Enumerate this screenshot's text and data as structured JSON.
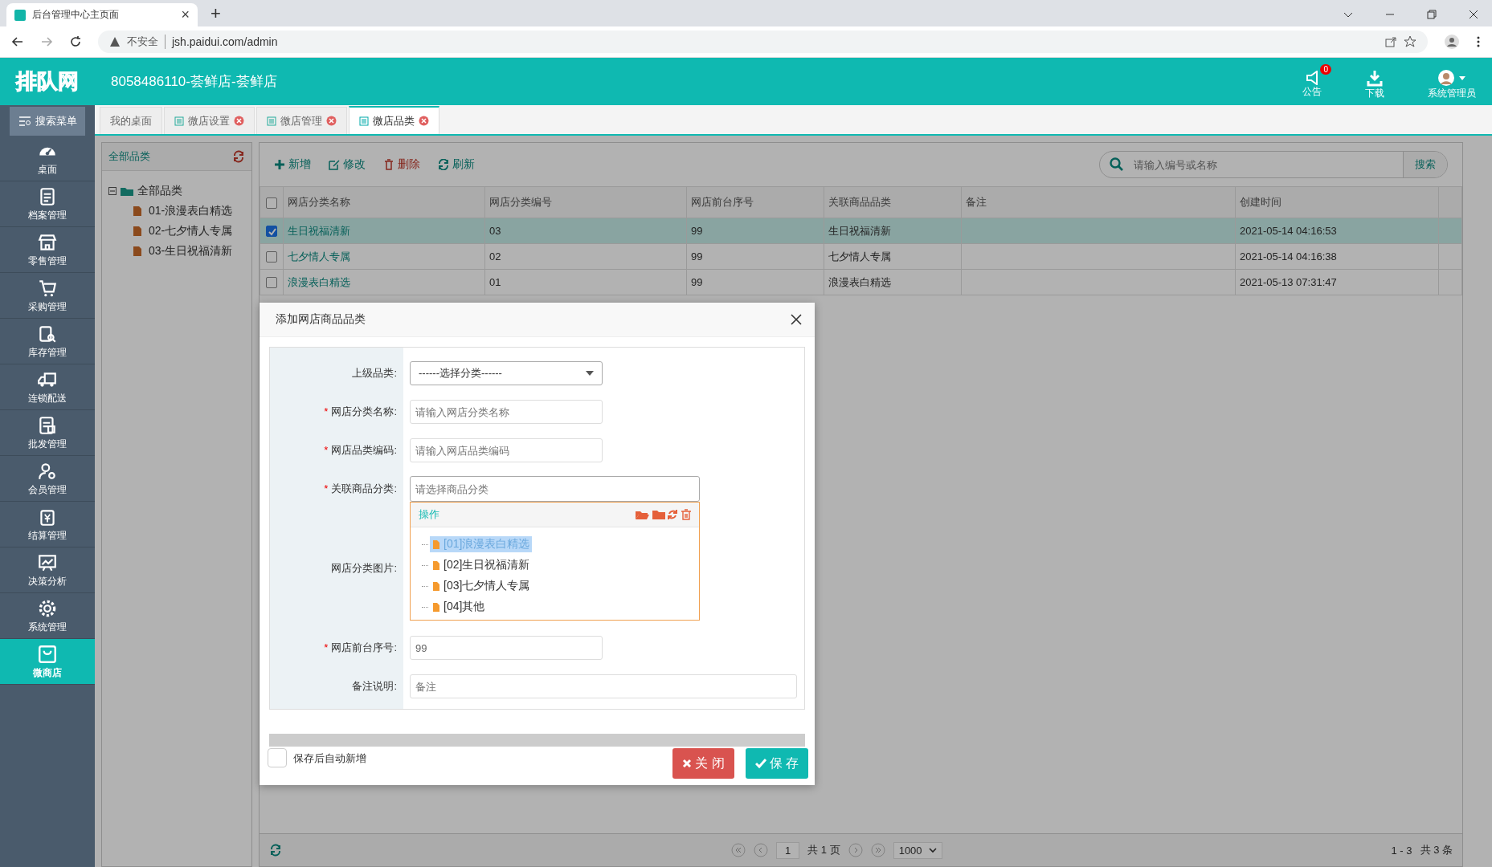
{
  "browser": {
    "tab_title": "后台管理中心主页面",
    "close": "×",
    "new_tab": "+",
    "url_warning": "不安全",
    "url": "jsh.paidui.com/admin"
  },
  "header": {
    "logo": "排队网",
    "store_title": "8058486110-荟鲜店-荟鲜店",
    "notice": {
      "label": "公告",
      "badge": "0"
    },
    "download": "下载",
    "user": "系统管理员"
  },
  "sidebar": {
    "search_menu": "搜索菜单",
    "items": [
      {
        "label": "桌面",
        "selected": false
      },
      {
        "label": "档案管理",
        "selected": false
      },
      {
        "label": "零售管理",
        "selected": false
      },
      {
        "label": "采购管理",
        "selected": false
      },
      {
        "label": "库存管理",
        "selected": false
      },
      {
        "label": "连锁配送",
        "selected": false
      },
      {
        "label": "批发管理",
        "selected": false
      },
      {
        "label": "会员管理",
        "selected": false
      },
      {
        "label": "结算管理",
        "selected": false
      },
      {
        "label": "决策分析",
        "selected": false
      },
      {
        "label": "系统管理",
        "selected": false
      },
      {
        "label": "微商店",
        "selected": true
      }
    ]
  },
  "tabs": [
    {
      "label": "我的桌面",
      "selected": false,
      "closable": false
    },
    {
      "label": "微店设置",
      "selected": false,
      "closable": true
    },
    {
      "label": "微店管理",
      "selected": false,
      "closable": true
    },
    {
      "label": "微店品类",
      "selected": true,
      "closable": true
    }
  ],
  "tree_panel": {
    "title": "全部品类",
    "root": {
      "label": "全部品类",
      "expanded": true,
      "children": [
        {
          "label": "01-浪漫表白精选"
        },
        {
          "label": "02-七夕情人专属"
        },
        {
          "label": "03-生日祝福清新"
        }
      ]
    }
  },
  "toolbar": {
    "buttons": [
      "新增",
      "修改",
      "删除",
      "刷新"
    ],
    "search_placeholder": "请输入编号或名称",
    "search_button": "搜索"
  },
  "table": {
    "select_all_checked": false,
    "columns": [
      "网店分类名称",
      "网店分类编号",
      "网店前台序号",
      "关联商品品类",
      "备注",
      "创建时间"
    ],
    "rows": [
      {
        "checked": true,
        "cells": [
          "生日祝福清新",
          "03",
          "99",
          "生日祝福清新",
          "",
          "2021-05-14 04:16:53"
        ]
      },
      {
        "checked": false,
        "cells": [
          "七夕情人专属",
          "02",
          "99",
          "七夕情人专属",
          "",
          "2021-05-14 04:16:38"
        ]
      },
      {
        "checked": false,
        "cells": [
          "浪漫表白精选",
          "01",
          "99",
          "浪漫表白精选",
          "",
          "2021-05-13 07:31:47"
        ]
      }
    ]
  },
  "pagination": {
    "page": "1",
    "pages": "共 1 页",
    "page_size": "1000",
    "range": "1 - 3",
    "total": "共 3 条"
  },
  "dialog": {
    "title": "添加网店商品品类",
    "required_mark": "*",
    "fields": [
      {
        "kind": "select",
        "label": "上级品类:",
        "required": false,
        "value": "------选择分类------"
      },
      {
        "kind": "input",
        "label": "网店分类名称:",
        "required": true,
        "placeholder": "请输入网店分类名称"
      },
      {
        "kind": "input",
        "label": "网店品类编码:",
        "required": true,
        "placeholder": "请输入网店品类编码"
      },
      {
        "kind": "tree",
        "label": "关联商品分类:",
        "required": true,
        "placeholder": "请选择商品分类"
      },
      {
        "kind": "image",
        "label": "网店分类图片:",
        "required": false
      },
      {
        "kind": "input",
        "label": "网店前台序号:",
        "required": true,
        "value": "99"
      },
      {
        "kind": "wide",
        "label": "备注说明:",
        "required": false,
        "placeholder": "备注"
      }
    ],
    "dropdown": {
      "header": "操作",
      "items": [
        {
          "label": "[01]浪漫表白精选",
          "selected": true
        },
        {
          "label": "[02]生日祝福清新",
          "selected": false
        },
        {
          "label": "[03]七夕情人专属",
          "selected": false
        },
        {
          "label": "[04]其他",
          "selected": false
        }
      ]
    },
    "auto_add": {
      "label": "保存后自动新增",
      "checked": false
    },
    "close_button": "关 闭",
    "save_button": "保 存"
  }
}
